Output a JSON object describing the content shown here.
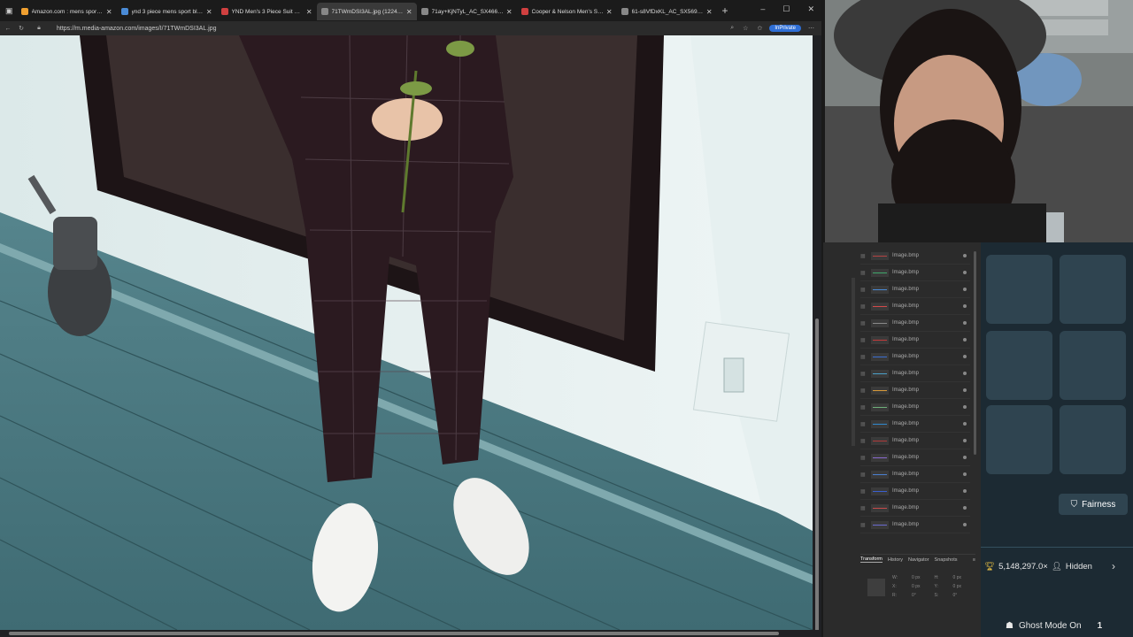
{
  "browser": {
    "tabs": [
      {
        "title": "Amazon.com : mens sport bl...",
        "active": false
      },
      {
        "title": "ynd 3 piece mens sport blazer",
        "active": false
      },
      {
        "title": "YND Men's 3 Piece Suit Set w...",
        "active": false
      },
      {
        "title": "71TWmDSI3AL.jpg (1224×16...",
        "active": true
      },
      {
        "title": "71ay+KjNTyL_AC_SX466_.jpg",
        "active": false
      },
      {
        "title": "Cooper & Nelson Men's Suit ...",
        "active": false
      },
      {
        "title": "61-s8VfDxKL_AC_SX569_.jpg",
        "active": false
      }
    ],
    "new_tab_glyph": "+",
    "url": "https://m.media-amazon.com/images/I/71TWmDSI3AL.jpg",
    "inprivate_label": "InPrivate"
  },
  "editor": {
    "layers": [
      {
        "name": "Image.bmp",
        "color": "#b44444"
      },
      {
        "name": "Image.bmp",
        "color": "#3fa86b"
      },
      {
        "name": "Image.bmp",
        "color": "#4a8bd6"
      },
      {
        "name": "Image.bmp",
        "color": "#d44a4a"
      },
      {
        "name": "Image.bmp",
        "color": "#8a8a8a"
      },
      {
        "name": "Image.bmp",
        "color": "#c23a3a"
      },
      {
        "name": "Image.bmp",
        "color": "#3b6fd1"
      },
      {
        "name": "Image.bmp",
        "color": "#4aa0c8"
      },
      {
        "name": "Image.bmp",
        "color": "#d89a3a"
      },
      {
        "name": "Image.bmp",
        "color": "#6fb07a"
      },
      {
        "name": "Image.bmp",
        "color": "#2f8ad0"
      },
      {
        "name": "Image.bmp",
        "color": "#b03a3a"
      },
      {
        "name": "Image.bmp",
        "color": "#8a6ad0"
      },
      {
        "name": "Image.bmp",
        "color": "#4a7fd0"
      },
      {
        "name": "Image.bmp",
        "color": "#3a5fd0"
      },
      {
        "name": "Image.bmp",
        "color": "#c84a4a"
      },
      {
        "name": "Image.bmp",
        "color": "#6a6ad0"
      }
    ],
    "panel_tabs": [
      "Transform",
      "History",
      "Navigator",
      "Snapshots"
    ],
    "transform_fields": [
      "W:",
      "0 px",
      "H:",
      "0 px",
      "X:",
      "0 px",
      "Y:",
      "0 px",
      "R:",
      "0°",
      "S:",
      "0°"
    ]
  },
  "overlay": {
    "fairness_label": "Fairness",
    "points": "5,148,297.0×",
    "visibility": "Hidden",
    "ghost_mode": "Ghost Mode On",
    "ghost_badge": "1"
  }
}
